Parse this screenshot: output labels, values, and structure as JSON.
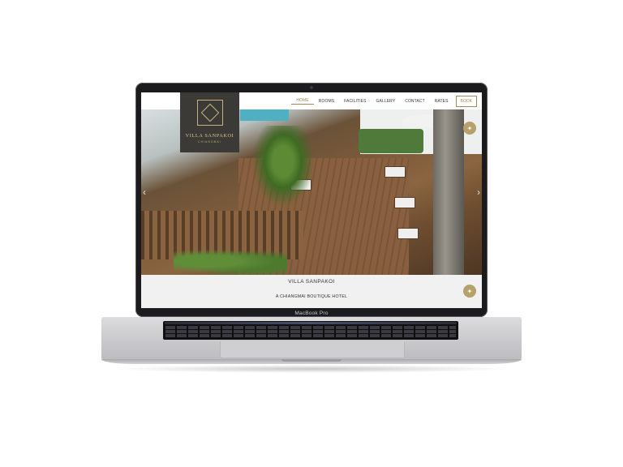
{
  "device": {
    "model_label": "MacBook Pro"
  },
  "site": {
    "logo": {
      "title": "VILLA SANPAKOI",
      "subtitle": "CHIANGMAI"
    },
    "nav": {
      "items": [
        "HOME",
        "ROOMS",
        "FACILITIES",
        "GALLERY",
        "CONTACT",
        "RATES"
      ],
      "active": "HOME",
      "book_label": "BOOK"
    },
    "hero": {
      "prev_icon": "chevron-left-icon",
      "next_icon": "chevron-right-icon"
    },
    "intro": {
      "title": "VILLA SANPAKOI",
      "subtitle": "A CHIANGMAI BOUTIQUE HOTEL"
    },
    "messenger_icon": "messenger-icon",
    "accent_color": "#a08a5c",
    "logo_bg_color": "#3b3a37"
  }
}
